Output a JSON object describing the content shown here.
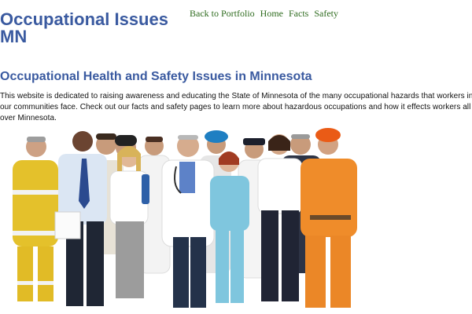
{
  "header": {
    "site_title": "Occupational Issues MN"
  },
  "nav": {
    "items": [
      {
        "label": "Back to Portfolio"
      },
      {
        "label": "Home"
      },
      {
        "label": "Facts"
      },
      {
        "label": "Safety"
      }
    ]
  },
  "main": {
    "heading": "Occupational Health and Safety Issues in Minnesota",
    "intro": "This website is dedicated to raising awareness and educating the State of Minnesota of the many occupational hazards that workers in our communities face. Check out our facts and safety pages to learn more about hazardous occupations and how it effects workers all over Minnesota."
  },
  "colors": {
    "title": "#3a5aa0",
    "nav_link": "#2e6b1e",
    "body_text": "#111111",
    "background": "#ffffff"
  }
}
